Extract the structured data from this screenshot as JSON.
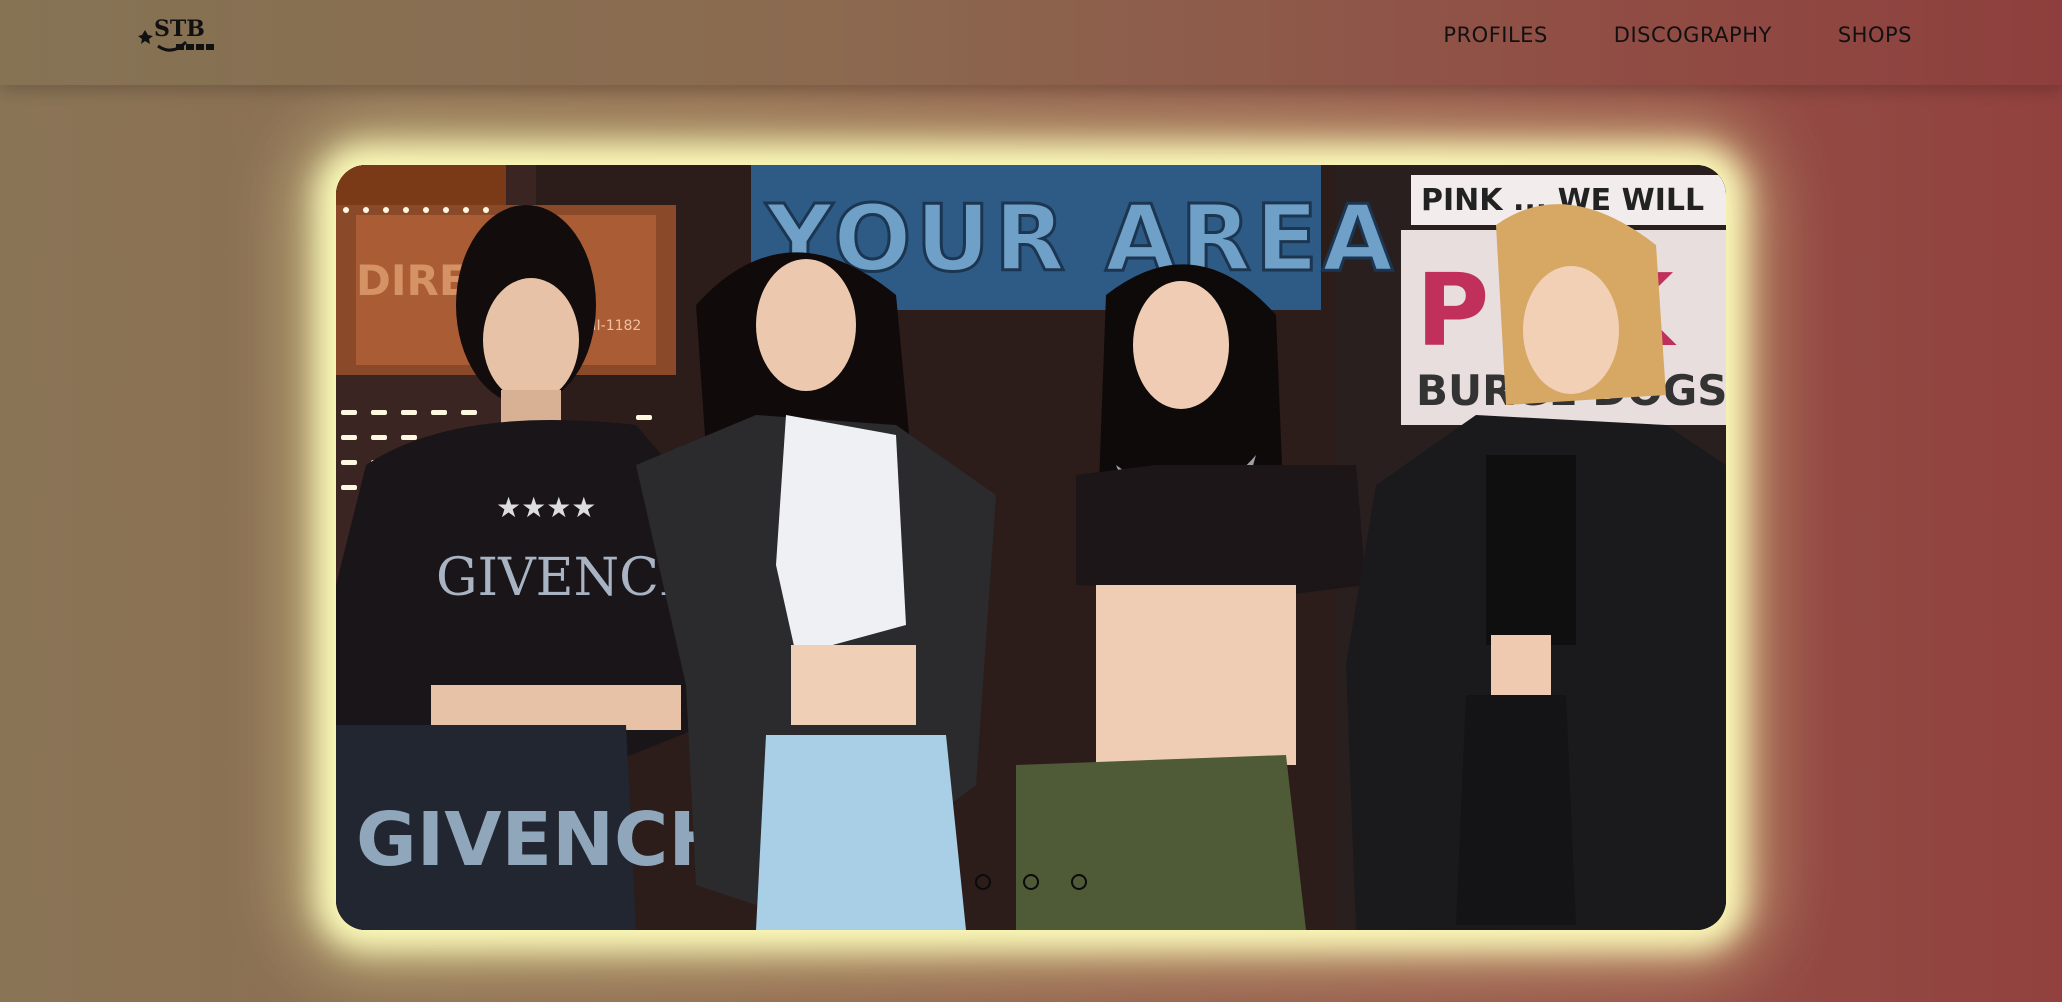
{
  "brand": {
    "logo_text": "STB",
    "logo_icon": "star-icon"
  },
  "nav": {
    "items": [
      {
        "label": "PROFILES"
      },
      {
        "label": "DISCOGRAPHY"
      },
      {
        "label": "SHOPS"
      }
    ]
  },
  "slider": {
    "signs": {
      "banner": "YOUR AREA",
      "pink_line": "PINK ... WE WILL",
      "pink_big": "P I   K",
      "burger": "BURGE    DOGS",
      "left_sign": "DIRE",
      "left_num": "HI-1182"
    },
    "shirt_text": {
      "top": "GIVENCHY",
      "skirt": "GIVENCH"
    },
    "dots_count": 3,
    "active_index": 0
  },
  "colors": {
    "glow": "#fffbbe",
    "dot": "#0a0a0a",
    "banner": "#2d5b86"
  }
}
